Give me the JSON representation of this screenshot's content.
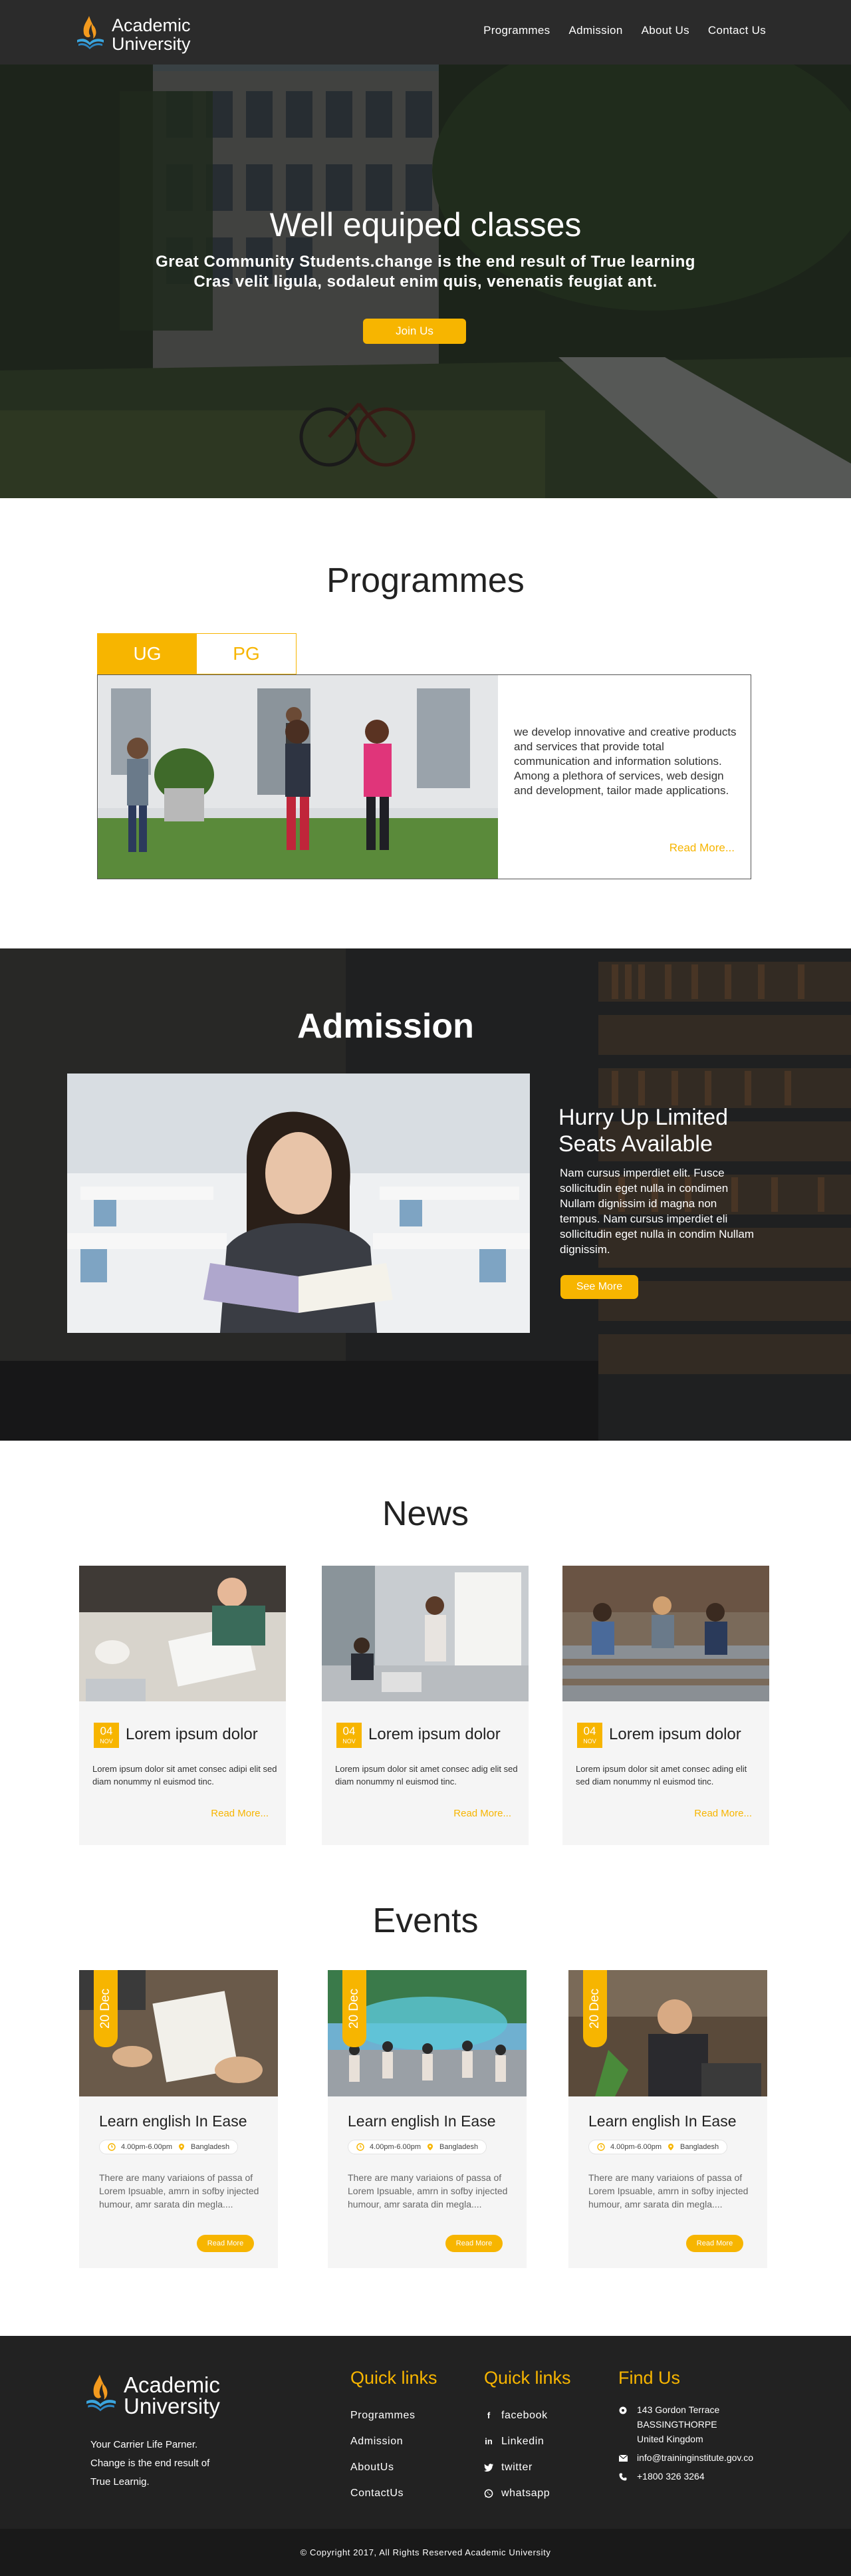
{
  "header": {
    "logo_line1": "Academic",
    "logo_line2": "University",
    "nav": [
      "Programmes",
      "Admission",
      "About Us",
      "Contact Us"
    ]
  },
  "hero": {
    "title": "Well equiped classes",
    "subtitle_line1": "Great Community Students.change is the end result of True learning",
    "subtitle_line2": "Cras velit ligula, sodaleut enim quis, venenatis feugiat ant.",
    "button": "Join Us"
  },
  "programmes": {
    "title": "Programmes",
    "tabs": [
      "UG",
      "PG"
    ],
    "active_tab": "UG",
    "text": "we develop innovative and creative products and services that provide total communication and information solutions. Among a plethora of services, web design and development, tailor made applications.",
    "read_more": "Read More..."
  },
  "admission": {
    "title": "Admission",
    "heading_line1": "Hurry Up Limited",
    "heading_line2": "Seats Available",
    "text": "Nam cursus imperdiet elit. Fusce sollicitudin eget nulla in condimen Nullam dignissim id magna non tempus. Nam cursus imperdiet eli sollicitudin eget nulla in condim Nullam dignissim.",
    "button": "See More"
  },
  "news": {
    "title": "News",
    "items": [
      {
        "day": "04",
        "month": "NOV",
        "heading": "Lorem ipsum dolor",
        "text": "Lorem ipsum dolor sit amet consec adipi elit sed diam nonummy nl euismod tinc.",
        "read_more": "Read More..."
      },
      {
        "day": "04",
        "month": "NOV",
        "heading": "Lorem ipsum dolor",
        "text": "Lorem ipsum dolor sit amet consec adig elit sed diam nonummy nl euismod tinc.",
        "read_more": "Read More..."
      },
      {
        "day": "04",
        "month": "NOV",
        "heading": "Lorem ipsum dolor",
        "text": "Lorem ipsum dolor sit amet consec ading elit sed diam nonummy nl euismod tinc.",
        "read_more": "Read More..."
      }
    ]
  },
  "events": {
    "title": "Events",
    "items": [
      {
        "date": "20 Dec",
        "heading": "Learn english In Ease",
        "time": "4.00pm-6.00pm",
        "location": "Bangladesh",
        "text": "There are many variaions of passa of Lorem Ipsuable, amrn in sofby injected humour, amr sarata din megla....",
        "button": "Read More"
      },
      {
        "date": "20 Dec",
        "heading": "Learn english In Ease",
        "time": "4.00pm-6.00pm",
        "location": "Bangladesh",
        "text": "There are many variaions of passa of Lorem Ipsuable, amrn in sofby injected humour, amr sarata din megla....",
        "button": "Read More"
      },
      {
        "date": "20 Dec",
        "heading": "Learn english In Ease",
        "time": "4.00pm-6.00pm",
        "location": "Bangladesh",
        "text": "There are many variaions of passa of Lorem Ipsuable, amrn in sofby injected humour, amr sarata din megla....",
        "button": "Read More"
      }
    ]
  },
  "footer": {
    "logo_line1": "Academic",
    "logo_line2": "University",
    "tagline_line1": "Your Carrier Life Parner.",
    "tagline_line2": "Change is the end result of",
    "tagline_line3": "True Learnig.",
    "quick_links_title": "Quick links",
    "quick_links": [
      "Programmes",
      "Admission",
      "AboutUs",
      "ContactUs"
    ],
    "social_title": "Quick links",
    "social_links": [
      "facebook",
      "Linkedin",
      "twitter",
      "whatsapp"
    ],
    "find_title": "Find Us",
    "address_line1": "143 Gordon Terrace",
    "address_line2": "BASSINGTHORPE",
    "address_line3": "United Kingdom",
    "email": "info@traininginstitute.gov.co",
    "phone": "+1800 326 3264",
    "copyright": "© Copyright 2017, All Rights Reserved Academic University"
  },
  "colors": {
    "accent": "#f7b500",
    "header_bg": "#2b2b2b",
    "footer_bg": "#222222",
    "card_bg": "#f5f5f5"
  }
}
